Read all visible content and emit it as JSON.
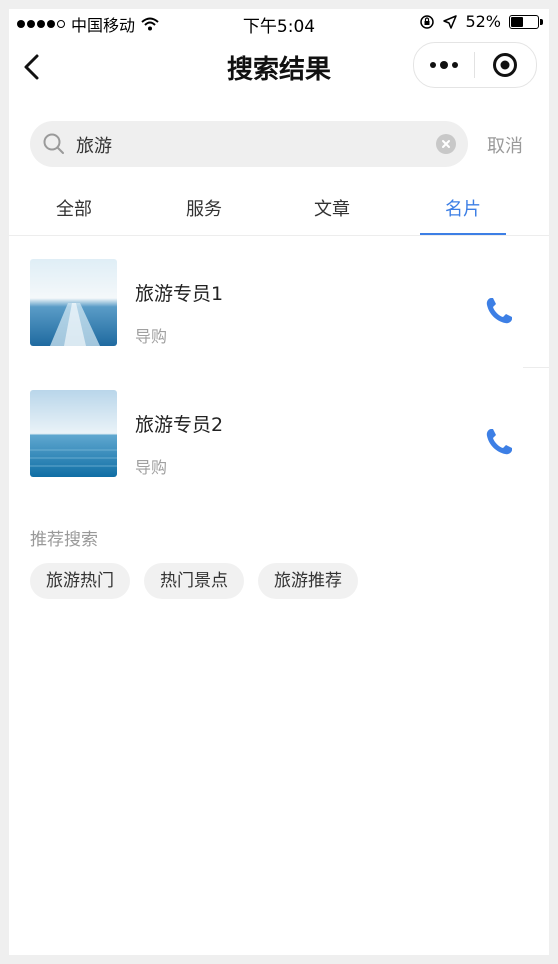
{
  "status_bar": {
    "carrier": "中国移动",
    "time": "下午5:04",
    "battery_percent": "52%",
    "battery_level": 0.52
  },
  "nav": {
    "title": "搜索结果",
    "back_icon": "chevron-left-icon",
    "more_icon": "more-dots-icon",
    "close_icon": "target-circle-icon"
  },
  "search": {
    "value": "旅游",
    "cancel_label": "取消"
  },
  "tabs": [
    {
      "label": "全部",
      "active": false
    },
    {
      "label": "服务",
      "active": false
    },
    {
      "label": "文章",
      "active": false
    },
    {
      "label": "名片",
      "active": true
    }
  ],
  "accent_color": "#3d7fe5",
  "results": [
    {
      "name": "旅游专员1",
      "role": "导购",
      "image": "ocean-wake-photo",
      "action_icon": "phone-icon"
    },
    {
      "name": "旅游专员2",
      "role": "导购",
      "image": "ocean-horizon-photo",
      "action_icon": "phone-icon"
    }
  ],
  "recommend": {
    "title": "推荐搜索",
    "chips": [
      "旅游热门",
      "热门景点",
      "旅游推荐"
    ]
  }
}
